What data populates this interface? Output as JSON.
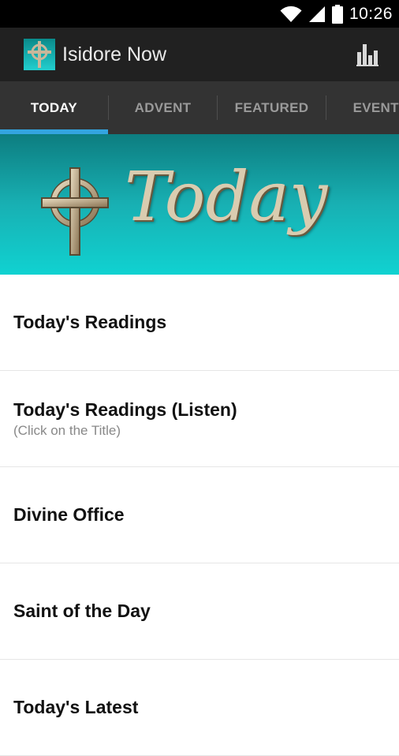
{
  "status_bar": {
    "time": "10:26"
  },
  "action_bar": {
    "title": "Isidore Now",
    "logo_icon": "cross-icon",
    "stats_icon": "bar-chart-icon"
  },
  "tabs": [
    {
      "label": "TODAY",
      "selected": true
    },
    {
      "label": "ADVENT",
      "selected": false
    },
    {
      "label": "FEATURED",
      "selected": false
    },
    {
      "label": "EVENTS",
      "selected": false
    }
  ],
  "banner": {
    "word": "Today"
  },
  "menu": [
    {
      "label": "Today's Readings",
      "sublabel": ""
    },
    {
      "label": "Today's Readings (Listen)",
      "sublabel": "(Click on the Title)"
    },
    {
      "label": "Divine Office",
      "sublabel": ""
    },
    {
      "label": "Saint of the Day",
      "sublabel": ""
    },
    {
      "label": "Today's Latest",
      "sublabel": ""
    }
  ],
  "colors": {
    "accent": "#33a4e0",
    "banner_top": "#0d7d80",
    "banner_bottom": "#10d2d1"
  }
}
